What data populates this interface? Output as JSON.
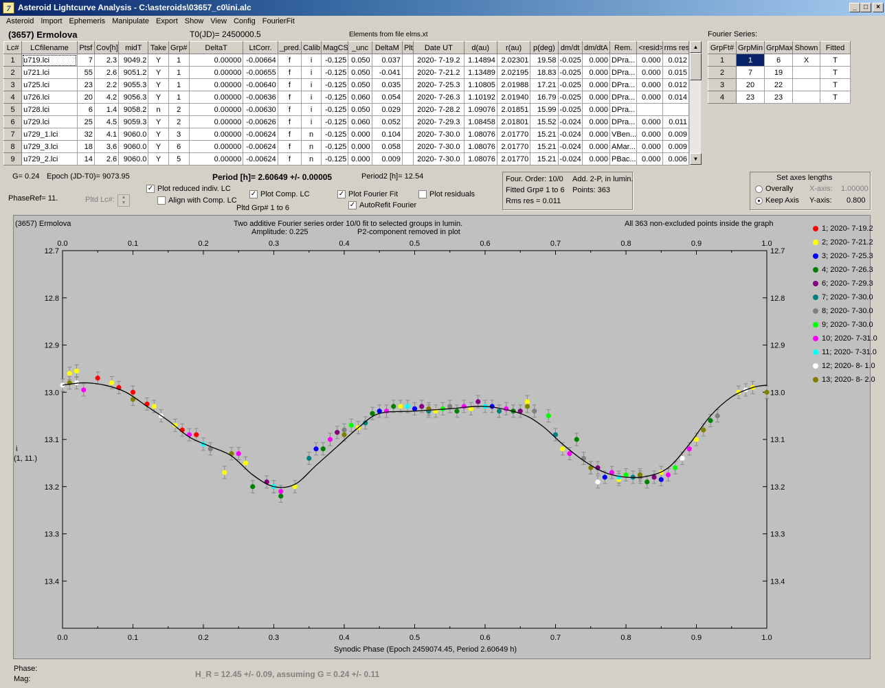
{
  "window": {
    "title": "Asteroid Lightcurve Analysis - C:\\asteroids\\03657_c0\\ini.alc",
    "icon_label": "7"
  },
  "menu": [
    "Asteroid",
    "Import",
    "Ephemeris",
    "Manipulate",
    "Export",
    "Show",
    "View",
    "Config",
    "FourierFit"
  ],
  "header": {
    "object": "(3657) Ermolova",
    "t0": "T0(JD)= 2450000.5",
    "elements": "Elements from file elms.xt",
    "fourier_title": "Fourier Series:"
  },
  "lc_table": {
    "columns": [
      "Lc#",
      "LCfilename",
      "Ptsf",
      "Cov[h]",
      "midT",
      "Take",
      "Grp#",
      "DeltaT",
      "LtCorr.",
      "_pred.",
      "Calib.",
      "MagCS",
      "_unc",
      "DeltaM",
      "Plt",
      "Date UT",
      "d(au)",
      "r(au)",
      "p(deg)",
      "dm/dt",
      "dm/dtA",
      "Rem.",
      "<resid>",
      "rms res"
    ],
    "rows": [
      [
        "1",
        "u719.lci",
        "7",
        "2.3",
        "9049.2",
        "Y",
        "1",
        "0.00000",
        "-0.00664",
        "f",
        "i",
        "-0.125",
        "0.050",
        "0.037",
        "",
        "2020- 7-19.2",
        "1.14894",
        "2.02301",
        "19.58",
        "-0.025",
        "0.000",
        "DPra...",
        "0.000",
        "0.012"
      ],
      [
        "2",
        "u721.lci",
        "55",
        "2.6",
        "9051.2",
        "Y",
        "1",
        "0.00000",
        "-0.00655",
        "f",
        "i",
        "-0.125",
        "0.050",
        "-0.041",
        "",
        "2020- 7-21.2",
        "1.13489",
        "2.02195",
        "18.83",
        "-0.025",
        "0.000",
        "DPra...",
        "0.000",
        "0.015"
      ],
      [
        "3",
        "u725.lci",
        "23",
        "2.2",
        "9055.3",
        "Y",
        "1",
        "0.00000",
        "-0.00640",
        "f",
        "i",
        "-0.125",
        "0.050",
        "0.035",
        "",
        "2020- 7-25.3",
        "1.10805",
        "2.01988",
        "17.21",
        "-0.025",
        "0.000",
        "DPra...",
        "0.000",
        "0.012"
      ],
      [
        "4",
        "u726.lci",
        "20",
        "4.2",
        "9056.3",
        "Y",
        "1",
        "0.00000",
        "-0.00636",
        "f",
        "i",
        "-0.125",
        "0.060",
        "0.054",
        "",
        "2020- 7-26.3",
        "1.10192",
        "2.01940",
        "16.79",
        "-0.025",
        "0.000",
        "DPra...",
        "0.000",
        "0.014"
      ],
      [
        "5",
        "u728.lci",
        "6",
        "1.4",
        "9058.2",
        "n",
        "2",
        "0.00000",
        "-0.00630",
        "f",
        "i",
        "-0.125",
        "0.050",
        "0.029",
        "",
        "2020- 7-28.2",
        "1.09076",
        "2.01851",
        "15.99",
        "-0.025",
        "0.000",
        "DPra...",
        "",
        ""
      ],
      [
        "6",
        "u729.lci",
        "25",
        "4.5",
        "9059.3",
        "Y",
        "2",
        "0.00000",
        "-0.00626",
        "f",
        "i",
        "-0.125",
        "0.060",
        "0.052",
        "",
        "2020- 7-29.3",
        "1.08458",
        "2.01801",
        "15.52",
        "-0.024",
        "0.000",
        "DPra...",
        "0.000",
        "0.011"
      ],
      [
        "7",
        "u729_1.lci",
        "32",
        "4.1",
        "9060.0",
        "Y",
        "3",
        "0.00000",
        "-0.00624",
        "f",
        "n",
        "-0.125",
        "0.000",
        "0.104",
        "",
        "2020- 7-30.0",
        "1.08076",
        "2.01770",
        "15.21",
        "-0.024",
        "0.000",
        "VBen...",
        "0.000",
        "0.009"
      ],
      [
        "8",
        "u729_3.lci",
        "18",
        "3.6",
        "9060.0",
        "Y",
        "6",
        "0.00000",
        "-0.00624",
        "f",
        "n",
        "-0.125",
        "0.000",
        "0.058",
        "",
        "2020- 7-30.0",
        "1.08076",
        "2.01770",
        "15.21",
        "-0.024",
        "0.000",
        "AMar...",
        "0.000",
        "0.009"
      ],
      [
        "9",
        "u729_2.lci",
        "14",
        "2.6",
        "9060.0",
        "Y",
        "5",
        "0.00000",
        "-0.00624",
        "f",
        "n",
        "-0.125",
        "0.000",
        "0.009",
        "",
        "2020- 7-30.0",
        "1.08076",
        "2.01770",
        "15.21",
        "-0.024",
        "0.000",
        "PBac...",
        "0.000",
        "0.006"
      ]
    ]
  },
  "fourier_table": {
    "columns": [
      "GrpFt#",
      "GrpMin",
      "GrpMax",
      "Shown",
      "Fitted"
    ],
    "rows": [
      [
        "1",
        "1",
        "6",
        "X",
        "T"
      ],
      [
        "2",
        "7",
        "19",
        "",
        "T"
      ],
      [
        "3",
        "20",
        "22",
        "",
        "T"
      ],
      [
        "4",
        "23",
        "23",
        "",
        "T"
      ]
    ]
  },
  "controls": {
    "g": "G= 0.24",
    "epoch": "Epoch (JD-T0)= 9073.95",
    "period": "Period [h]= 2.60649 +/- 0.00005",
    "period2": "Period2 [h]= 12.54",
    "phaseref": "PhaseRef= 11.",
    "pltd_lc": "Pltd Lc#:",
    "plot_reduced": "Plot reduced indiv. LC",
    "align_comp": "Align with Comp. LC",
    "plot_comp": "Plot Comp. LC",
    "pltd_grp": "Pltd Grp#  1   to   6",
    "plot_fourier": "Plot Fourier Fit",
    "autorefit": "AutoRefit Fourier",
    "plot_residuals": "Plot residuals",
    "info": {
      "order": "Four. Order: 10/0",
      "add": "Add. 2-P, in lumin.",
      "fitted": "Fitted Grp# 1 to 6",
      "points": "Points: 363",
      "rms": "Rms res     = 0.011"
    },
    "axes": {
      "title": "Set axes lengths",
      "overally": "Overally",
      "keep": "Keep Axis",
      "xaxis": "X-axis:",
      "xval": "1.00000",
      "yaxis": "Y-axis:",
      "yval": "0.800"
    }
  },
  "chart_data": {
    "type": "scatter",
    "object": "(3657) Ermolova",
    "title": "Two additive Fourier series order 10/0 fit to selected groups in lumin.",
    "amplitude": "Amplitude: 0.225",
    "note": "P2-component removed in plot",
    "points_note": "All 363 non-excluded points inside the graph",
    "xlabel": "Synodic Phase (Epoch 2459074.45, Period 2.60649 h)",
    "ylabel": "i",
    "ylabel2": "(1, 11.)",
    "xlim": [
      0,
      1
    ],
    "ylim": [
      12.7,
      13.5
    ],
    "y_reversed": true,
    "xticks": [
      "0.0",
      "0.1",
      "0.2",
      "0.3",
      "0.4",
      "0.5",
      "0.6",
      "0.7",
      "0.8",
      "0.9",
      "1.0"
    ],
    "yticks": [
      "12.7",
      "12.8",
      "12.9",
      "13.0",
      "13.1",
      "13.2",
      "13.3",
      "13.4"
    ],
    "fit_curve": {
      "x": [
        0.0,
        0.03,
        0.06,
        0.09,
        0.12,
        0.15,
        0.18,
        0.21,
        0.24,
        0.27,
        0.3,
        0.33,
        0.36,
        0.39,
        0.42,
        0.45,
        0.5,
        0.55,
        0.6,
        0.65,
        0.68,
        0.71,
        0.74,
        0.77,
        0.8,
        0.83,
        0.86,
        0.89,
        0.92,
        0.95,
        0.98,
        1.0
      ],
      "y": [
        12.985,
        12.98,
        12.985,
        13.0,
        13.03,
        13.06,
        13.095,
        13.115,
        13.135,
        13.175,
        13.2,
        13.195,
        13.155,
        13.115,
        13.075,
        13.045,
        13.04,
        13.035,
        13.03,
        13.045,
        13.07,
        13.11,
        13.145,
        13.17,
        13.18,
        13.178,
        13.16,
        13.11,
        13.05,
        13.01,
        12.99,
        12.985
      ]
    },
    "series": [
      {
        "name": "1; 2020- 7-19.2",
        "color": "#ff0000",
        "x": [
          0.0,
          0.05,
          0.08,
          0.1,
          0.12,
          0.17,
          0.19
        ],
        "y": [
          12.985,
          12.97,
          12.99,
          13.0,
          13.025,
          13.08,
          13.09
        ]
      },
      {
        "name": "2; 2020- 7-21.2",
        "color": "#ffff00",
        "x": [
          0.01,
          0.02,
          0.07,
          0.13,
          0.16,
          0.23,
          0.26,
          0.33,
          0.42,
          0.48,
          0.53,
          0.58,
          0.62,
          0.66,
          0.71,
          0.75,
          0.79,
          0.85,
          0.9,
          0.96,
          0.98
        ],
        "y": [
          12.96,
          12.955,
          12.98,
          13.03,
          13.07,
          13.17,
          13.15,
          13.2,
          13.075,
          13.03,
          13.04,
          13.035,
          13.04,
          13.02,
          13.12,
          13.16,
          13.185,
          13.17,
          13.1,
          13.0,
          12.99
        ]
      },
      {
        "name": "3; 2020- 7-25.3",
        "color": "#0000ff",
        "x": [
          0.3,
          0.36,
          0.45,
          0.5,
          0.61,
          0.77,
          0.85
        ],
        "y": [
          13.2,
          13.12,
          13.04,
          13.035,
          13.03,
          13.18,
          13.185
        ]
      },
      {
        "name": "4; 2020- 7-26.3",
        "color": "#008000",
        "x": [
          0.27,
          0.31,
          0.37,
          0.44,
          0.47,
          0.56,
          0.64,
          0.73,
          0.83,
          0.92
        ],
        "y": [
          13.2,
          13.22,
          13.12,
          13.045,
          13.03,
          13.04,
          13.04,
          13.1,
          13.19,
          13.06
        ]
      },
      {
        "name": "6; 2020- 7-29.3",
        "color": "#800080",
        "x": [
          0.29,
          0.39,
          0.51,
          0.59,
          0.65,
          0.76,
          0.84
        ],
        "y": [
          13.19,
          13.085,
          13.03,
          13.02,
          13.04,
          13.16,
          13.18
        ]
      },
      {
        "name": "7; 2020- 7-30.0",
        "color": "#008080",
        "x": [
          0.35,
          0.43,
          0.52,
          0.62,
          0.7,
          0.81
        ],
        "y": [
          13.14,
          13.065,
          13.04,
          13.04,
          13.09,
          13.18
        ]
      },
      {
        "name": "8; 2020- 7-30.0",
        "color": "#808080",
        "x": [
          0.21,
          0.4,
          0.55,
          0.67,
          0.74,
          0.82,
          0.93
        ],
        "y": [
          13.12,
          13.08,
          13.03,
          13.04,
          13.14,
          13.18,
          13.05
        ]
      },
      {
        "name": "9; 2020- 7-30.0",
        "color": "#00ff00",
        "x": [
          0.41,
          0.54,
          0.69,
          0.8,
          0.87
        ],
        "y": [
          13.07,
          13.035,
          13.05,
          13.175,
          13.16
        ]
      },
      {
        "name": "10; 2020- 7-31.0",
        "color": "#ff00ff",
        "x": [
          0.03,
          0.18,
          0.25,
          0.31,
          0.38,
          0.46,
          0.57,
          0.63,
          0.72,
          0.78,
          0.86,
          0.89
        ],
        "y": [
          12.995,
          13.09,
          13.13,
          13.21,
          13.1,
          13.04,
          13.03,
          13.035,
          13.13,
          13.17,
          13.175,
          13.12
        ]
      },
      {
        "name": "11; 2020- 7-31.0",
        "color": "#00ffff",
        "x": [
          0.2,
          0.3,
          0.49,
          0.6,
          0.79
        ],
        "y": [
          13.11,
          13.2,
          13.03,
          13.03,
          13.18
        ]
      },
      {
        "name": "12; 2020- 8- 1.0",
        "color": "#ffffff",
        "x": [
          0.0,
          0.02,
          0.14,
          0.76,
          0.88,
          0.97
        ],
        "y": [
          12.985,
          12.98,
          13.05,
          13.19,
          13.14,
          12.995
        ]
      },
      {
        "name": "13; 2020- 8- 2.0",
        "color": "#808000",
        "x": [
          0.01,
          0.1,
          0.24,
          0.4,
          0.52,
          0.66,
          0.75,
          0.82,
          0.91,
          1.0
        ],
        "y": [
          12.98,
          13.015,
          13.13,
          13.09,
          13.035,
          13.03,
          13.16,
          13.175,
          13.08,
          13.0
        ]
      }
    ]
  },
  "bottom": {
    "phase": "Phase:",
    "mag": "Mag:",
    "hr": "H_R = 12.45 +/- 0.09, assuming G = 0.24 +/- 0.11"
  }
}
